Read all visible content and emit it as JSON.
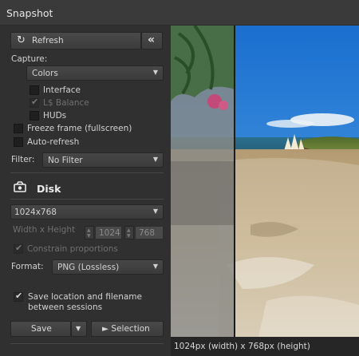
{
  "window": {
    "title": "Snapshot"
  },
  "toolbar": {
    "refresh_label": "Refresh",
    "collapse_glyph": "«"
  },
  "capture": {
    "label": "Capture:",
    "type_value": "Colors",
    "options": [
      {
        "label": "Interface",
        "checked": false,
        "disabled": false
      },
      {
        "label": "L$ Balance",
        "checked": true,
        "disabled": true
      },
      {
        "label": "HUDs",
        "checked": false,
        "disabled": false
      }
    ],
    "freeze_frame_label": "Freeze frame (fullscreen)",
    "auto_refresh_label": "Auto-refresh"
  },
  "filter": {
    "label": "Filter:",
    "value": "No Filter"
  },
  "disk": {
    "title": "Disk",
    "resolution_value": "1024x768",
    "size_label": "Width x Height",
    "width_value": "1024",
    "height_value": "768",
    "constrain_label": "Constrain proportions",
    "format_label": "Format:",
    "format_value": "PNG (Lossless)",
    "save_location_label_line1": "Save location and filename",
    "save_location_label_line2": "between sessions",
    "save_label": "Save",
    "selection_label": "► Selection"
  },
  "status": {
    "text": "1024px (width) x 768px (height)"
  },
  "icons": [
    "refresh-icon",
    "collapse-icon",
    "chevron-down-icon",
    "checkmark-icon",
    "disk-icon",
    "spinner-arrows-icon"
  ]
}
